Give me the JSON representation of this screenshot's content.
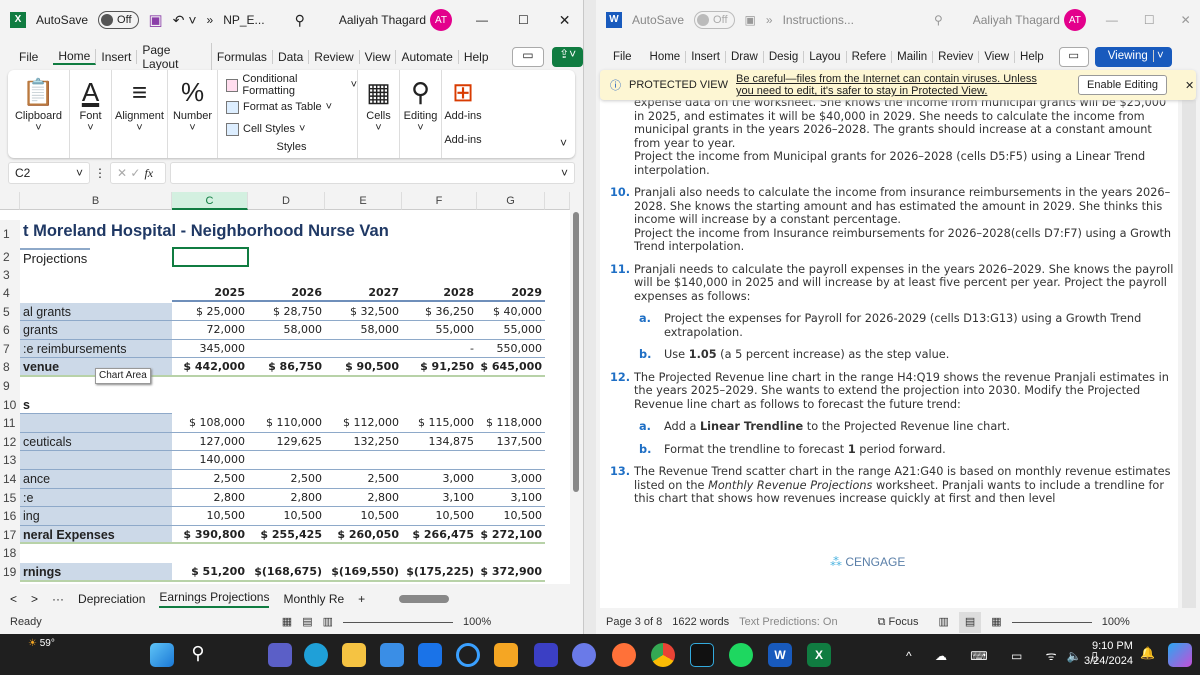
{
  "excel": {
    "autosave_label": "AutoSave",
    "autosave_state": "Off",
    "file_name": "NP_E...",
    "user": "Aaliyah Thagard",
    "initials": "AT",
    "tabs": [
      "File",
      "Home",
      "Insert",
      "Page Layout",
      "Formulas",
      "Data",
      "Review",
      "View",
      "Automate",
      "Help"
    ],
    "ribbon": {
      "clipboard": "Clipboard",
      "font": "Font",
      "alignment": "Alignment",
      "number": "Number",
      "cond_fmt": "Conditional Formatting",
      "fmt_table": "Format as Table",
      "cell_styles": "Cell Styles",
      "styles": "Styles",
      "cells": "Cells",
      "editing": "Editing",
      "addins": "Add-ins",
      "addins_group": "Add-ins"
    },
    "name_box": "C2",
    "fx": "fx",
    "columns": [
      "B",
      "C",
      "D",
      "E",
      "F",
      "G"
    ],
    "title": "t Moreland Hospital - Neighborhood Nurse Van",
    "subtitle": "Projections",
    "years": [
      "2025",
      "2026",
      "2027",
      "2028",
      "2029"
    ],
    "rows": [
      {
        "r": "5",
        "label": "al grants",
        "vals": [
          "$    25,000",
          "$    28,750",
          "$    32,500",
          "$    36,250",
          "$    40,000"
        ],
        "bold": false,
        "shade": true
      },
      {
        "r": "6",
        "label": "grants",
        "vals": [
          "72,000",
          "58,000",
          "58,000",
          "55,000",
          "55,000"
        ],
        "bold": false,
        "shade": true
      },
      {
        "r": "7",
        "label": ":e reimbursements",
        "vals": [
          "345,000",
          "",
          "",
          "-",
          "550,000"
        ],
        "bold": false,
        "shade": true
      },
      {
        "r": "8",
        "label": "venue",
        "vals": [
          "$ 442,000",
          "$   86,750",
          "$   90,500",
          "$   91,250",
          "$ 645,000"
        ],
        "bold": true,
        "shade": true
      },
      {
        "r": "9",
        "label": "",
        "vals": [
          "",
          "",
          "",
          "",
          ""
        ],
        "bold": false,
        "shade": false
      },
      {
        "r": "10",
        "label": "s",
        "vals": [
          "",
          "",
          "",
          "",
          ""
        ],
        "bold": true,
        "shade": false
      },
      {
        "r": "11",
        "label": "",
        "vals": [
          "$ 108,000",
          "$ 110,000",
          "$ 112,000",
          "$ 115,000",
          "$ 118,000"
        ],
        "bold": false,
        "shade": true
      },
      {
        "r": "12",
        "label": "ceuticals",
        "vals": [
          "127,000",
          "129,625",
          "132,250",
          "134,875",
          "137,500"
        ],
        "bold": false,
        "shade": true
      },
      {
        "r": "13",
        "label": "",
        "vals": [
          "140,000",
          "",
          "",
          "",
          ""
        ],
        "bold": false,
        "shade": true
      },
      {
        "r": "14",
        "label": "ance",
        "vals": [
          "2,500",
          "2,500",
          "2,500",
          "3,000",
          "3,000"
        ],
        "bold": false,
        "shade": true
      },
      {
        "r": "15",
        "label": ":e",
        "vals": [
          "2,800",
          "2,800",
          "2,800",
          "3,100",
          "3,100"
        ],
        "bold": false,
        "shade": true
      },
      {
        "r": "16",
        "label": "ing",
        "vals": [
          "10,500",
          "10,500",
          "10,500",
          "10,500",
          "10,500"
        ],
        "bold": false,
        "shade": true
      },
      {
        "r": "17",
        "label": "neral Expenses",
        "vals": [
          "$ 390,800",
          "$ 255,425",
          "$ 260,050",
          "$ 266,475",
          "$ 272,100"
        ],
        "bold": true,
        "shade": true
      },
      {
        "r": "18",
        "label": "",
        "vals": [
          "",
          "",
          "",
          "",
          ""
        ],
        "bold": false,
        "shade": false
      },
      {
        "r": "19",
        "label": "rnings",
        "vals": [
          "$   51,200",
          "$(168,675)",
          "$(169,550)",
          "$(175,225)",
          "$ 372,900"
        ],
        "bold": true,
        "shade": true
      }
    ],
    "tooltip": "Chart Area",
    "sheet_tabs": [
      "Depreciation",
      "Earnings Projections",
      "Monthly Re"
    ],
    "active_sheet": "Earnings Projections",
    "status": "Ready",
    "zoom": "100%"
  },
  "word": {
    "autosave_label": "AutoSave",
    "autosave_state": "Off",
    "file_name": "Instructions...",
    "user": "Aaliyah Thagard",
    "initials": "AT",
    "tabs": [
      "File",
      "Home",
      "Insert",
      "Draw",
      "Desig",
      "Layou",
      "Refere",
      "Mailin",
      "Reviev",
      "View",
      "Help"
    ],
    "viewing": "Viewing",
    "protected_label": "PROTECTED VIEW",
    "protected_msg": "Be careful—files from the Internet can contain viruses. Unless you need to edit, it's safer to stay in Protected View.",
    "enable_editing": "Enable Editing",
    "intro": "expense data on the worksheet. She knows the income from municipal grants will be $25,000 in 2025, and estimates it will be $40,000 in 2029. She needs to calculate the income from municipal grants in the years 2026–2028. The grants should increase at a constant amount from year to year.",
    "intro2": "Project the income from Municipal grants for 2026–2028 (cells D5:F5) using a Linear Trend interpolation.",
    "items": [
      {
        "n": "10.",
        "text": "Pranjali also needs to calculate the income from insurance reimbursements in the years 2026–2028. She knows the starting amount and has estimated the amount in 2029. She thinks this income will increase by a constant percentage.",
        "text2": "Project the income from Insurance reimbursements for 2026–2028(cells D7:F7) using a Growth Trend interpolation."
      },
      {
        "n": "11.",
        "text": "Pranjali needs to calculate the payroll expenses in the years 2026–2029. She knows the payroll will be $140,000 in 2025 and will increase by at least five percent per year. Project the payroll expenses as follows:"
      },
      {
        "n": "12.",
        "text": "The Projected Revenue line chart in the range H4:Q19 shows the revenue Pranjali estimates in the years 2025–2029. She wants to extend the projection into 2030. Modify the Projected Revenue line chart as follows to forecast the future trend:"
      },
      {
        "n": "13.",
        "text": "The Revenue Trend scatter chart in the range A21:G40 is based on monthly revenue estimates listed on the",
        "em": "Monthly Revenue Projections",
        "text2": "worksheet. Pranjali wants to include a trendline for this chart that shows how revenues increase quickly at first and then level"
      }
    ],
    "sub11": [
      {
        "n": "a.",
        "text": "Project the expenses for Payroll for 2026-2029 (cells D13:G13) using a Growth Trend extrapolation."
      },
      {
        "n": "b.",
        "pre": "Use ",
        "bold": "1.05",
        "post": " (a 5 percent increase) as the step value."
      }
    ],
    "sub12": [
      {
        "n": "a.",
        "pre": "Add a ",
        "bold": "Linear Trendline",
        "post": " to the Projected Revenue line chart."
      },
      {
        "n": "b.",
        "pre": "Format the trendline to forecast ",
        "bold": "1",
        "post": " period forward."
      }
    ],
    "logo": "CENGAGE",
    "status": {
      "page": "Page 3 of 8",
      "words": "1622 words",
      "predictions": "Text Predictions: On",
      "focus": "Focus",
      "zoom": "100%"
    }
  },
  "taskbar": {
    "weather": "59°",
    "time": "9:10 PM",
    "date": "3/24/2024"
  },
  "colors": {
    "excel_green": "#107c41",
    "word_blue": "#185abd",
    "label_shade": "#ccd9e8",
    "protected_bg": "#fdf6d3"
  }
}
